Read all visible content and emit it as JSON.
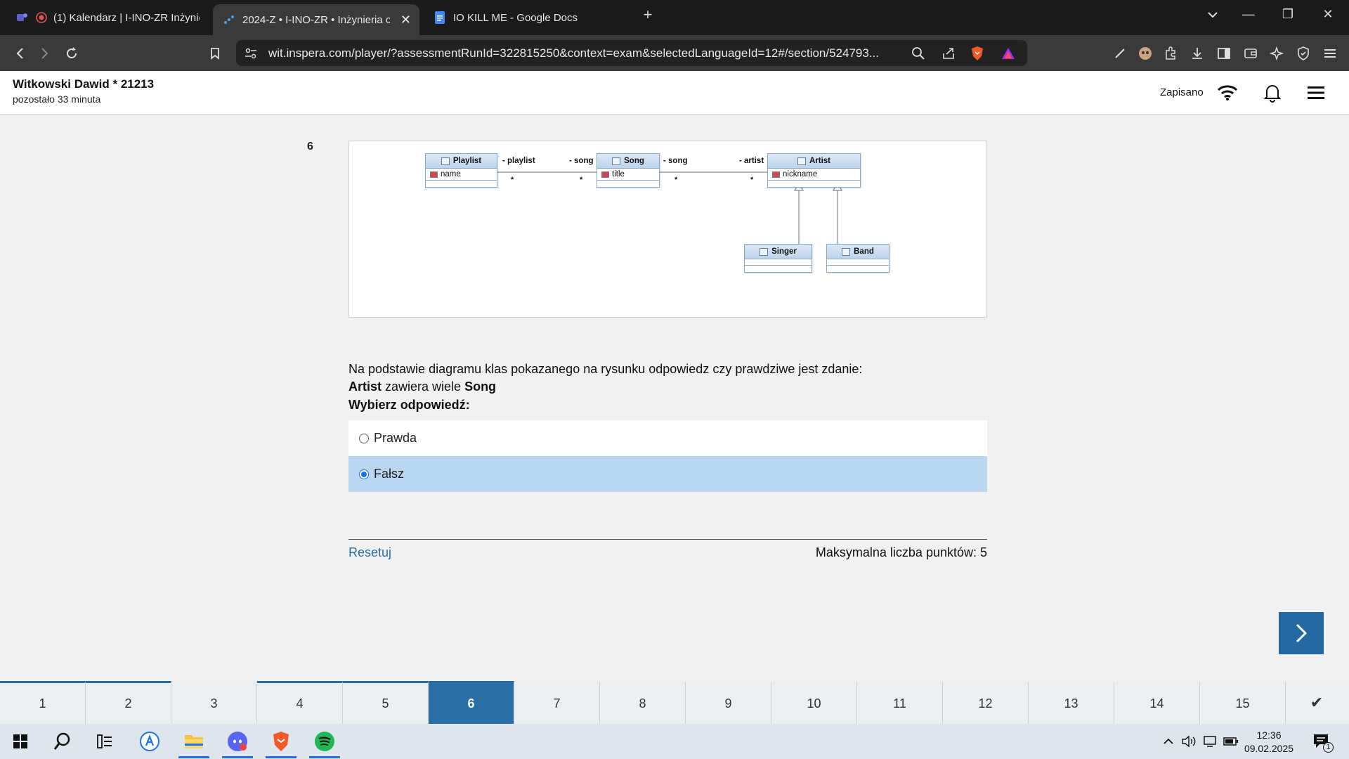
{
  "browser": {
    "tabs": [
      {
        "label": "(1) Kalendarz | I-INO-ZR Inżynier",
        "active": false
      },
      {
        "label": "2024-Z • I-INO-ZR • Inżynieria o",
        "active": true
      },
      {
        "label": "IO KILL ME - Google Docs",
        "active": false
      }
    ],
    "url": "wit.inspera.com/player/?assessmentRunId=322815250&context=exam&selectedLanguageId=12#/section/524793..."
  },
  "header": {
    "student": "Witkowski Dawid * 21213",
    "time_left": "pozostało 33 minuta",
    "saved_status": "Zapisano"
  },
  "question": {
    "number": "6",
    "line1": "Na podstawie diagramu klas pokazanego na rysunku odpowiedz czy prawdziwe jest zdanie:",
    "statement_a": "Artist",
    "statement_mid": " zawiera wiele ",
    "statement_b": "Song",
    "prompt": "Wybierz odpowiedź:",
    "options": [
      {
        "label": "Prawda",
        "selected": false
      },
      {
        "label": "Fałsz",
        "selected": true
      }
    ],
    "reset_label": "Resetuj",
    "max_points": "Maksymalna liczba punktów: 5"
  },
  "diagram": {
    "classes": [
      {
        "name": "Playlist",
        "attribute": "name"
      },
      {
        "name": "Song",
        "attribute": "title"
      },
      {
        "name": "Artist",
        "attribute": "nickname"
      },
      {
        "name": "Singer",
        "attribute": ""
      },
      {
        "name": "Band",
        "attribute": ""
      }
    ],
    "roles": {
      "playlist": "- playlist",
      "song_left": "- song",
      "song_right": "- song",
      "artist": "- artist"
    },
    "multiplicity": "*"
  },
  "question_nav": {
    "items": [
      "1",
      "2",
      "3",
      "4",
      "5",
      "6",
      "7",
      "8",
      "9",
      "10",
      "11",
      "12",
      "13",
      "14",
      "15"
    ],
    "current": "6"
  },
  "taskbar": {
    "time": "12:36",
    "date": "09.02.2025",
    "notifications": "1"
  },
  "colors": {
    "accent": "#2a6ea8",
    "selected_option": "#b9d7f0",
    "page_bg": "#f1f1f1"
  }
}
